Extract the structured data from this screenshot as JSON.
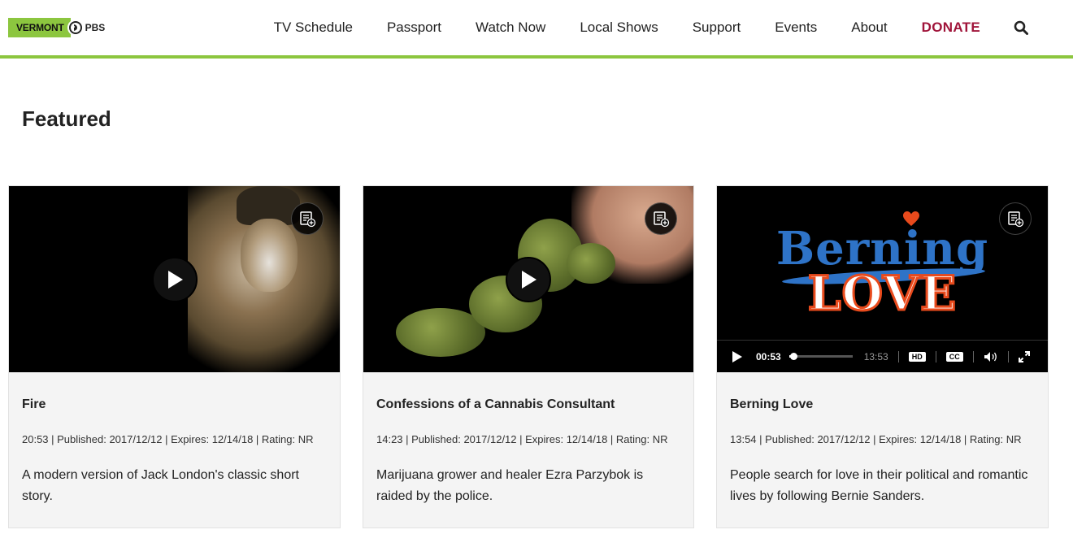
{
  "header": {
    "logo": {
      "vermont": "VERMONT",
      "pbs": "PBS"
    },
    "nav": [
      "TV Schedule",
      "Passport",
      "Watch Now",
      "Local Shows",
      "Support",
      "Events",
      "About"
    ],
    "donate": "DONATE",
    "search_icon": "search-icon"
  },
  "section": {
    "title": "Featured"
  },
  "cards": [
    {
      "title": "Fire",
      "meta": "20:53 | Published: 2017/12/12 | Expires: 12/14/18 | Rating: NR",
      "description": "A modern version of Jack London's classic short story."
    },
    {
      "title": "Confessions of a Cannabis Consultant",
      "meta": "14:23 | Published: 2017/12/12 | Expires: 12/14/18 | Rating: NR",
      "description": "Marijuana grower and healer Ezra Parzybok is raided by the police."
    },
    {
      "title": "Berning Love",
      "meta": "13:54 | Published: 2017/12/12 | Expires: 12/14/18 | Rating: NR",
      "description": "People search for love in their political and romantic lives by following Bernie Sanders.",
      "video": {
        "art_top": "Berning",
        "art_bottom": "LOVE",
        "current_time": "00:53",
        "duration": "13:53",
        "progress_fraction": 0.064,
        "hd_label": "HD",
        "cc_label": "CC"
      }
    }
  ],
  "colors": {
    "accent": "#8cc63f",
    "donate": "#a0143a",
    "card_bg": "#f4f4f4",
    "art_blue": "#2e73c7",
    "art_orange": "#e84a1c"
  }
}
